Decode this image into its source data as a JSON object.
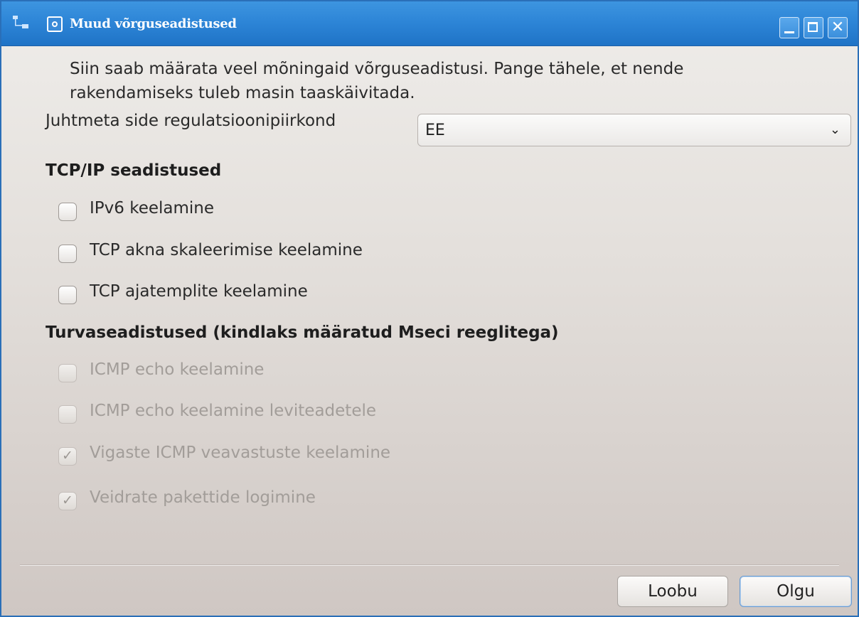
{
  "window": {
    "title": "Muud võrguseadistused",
    "icons": [
      "network-icon",
      "app-icon"
    ],
    "controls": {
      "minimize": "",
      "maximize": "",
      "close": "✕"
    }
  },
  "intro_text": "Siin saab määrata veel mõningaid võrguseadistusi. Pange tähele, et nende rakendamiseks tuleb masin taaskäivitada.",
  "regulatory": {
    "label": "Juhtmeta side regulatsioonipiirkond",
    "value": "EE",
    "arrow": "⌄"
  },
  "tcp_section": {
    "heading": "TCP/IP seadistused",
    "options": [
      {
        "label": "IPv6 keelamine",
        "checked": false,
        "enabled": true
      },
      {
        "label": "TCP akna skaleerimise keelamine",
        "checked": false,
        "enabled": true
      },
      {
        "label": "TCP ajatemplite keelamine",
        "checked": false,
        "enabled": true
      }
    ]
  },
  "security_section": {
    "heading": "Turvaseadistused (kindlaks määratud Mseci reeglitega)",
    "options": [
      {
        "label": "ICMP echo keelamine",
        "checked": false,
        "enabled": false
      },
      {
        "label": "ICMP echo keelamine leviteadetele",
        "checked": false,
        "enabled": false
      },
      {
        "label": "Vigaste ICMP veavastuste keelamine",
        "checked": true,
        "enabled": false
      },
      {
        "label": "Veidrate pakettide logimine",
        "checked": true,
        "enabled": false
      }
    ]
  },
  "buttons": {
    "cancel": "Loobu",
    "ok": "Olgu"
  },
  "colors": {
    "titlebar": "#2c84d6",
    "border": "#2a6fb8",
    "disabled_text": "#a29d99"
  }
}
